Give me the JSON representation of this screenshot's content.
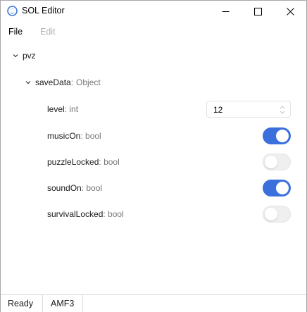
{
  "window": {
    "title": "SOL Editor",
    "accent_color": "#3a6fdc"
  },
  "menu": {
    "file": "File",
    "edit": "Edit"
  },
  "tree": {
    "root": {
      "name": "pvz"
    },
    "child": {
      "name": "saveData",
      "type": "Object"
    },
    "properties": [
      {
        "key": "level",
        "type": "int",
        "value": "12"
      },
      {
        "key": "musicOn",
        "type": "bool",
        "value": true
      },
      {
        "key": "puzzleLocked",
        "type": "bool",
        "value": false
      },
      {
        "key": "soundOn",
        "type": "bool",
        "value": true
      },
      {
        "key": "survivalLocked",
        "type": "bool",
        "value": false
      }
    ]
  },
  "status": {
    "state": "Ready",
    "format": "AMF3"
  }
}
